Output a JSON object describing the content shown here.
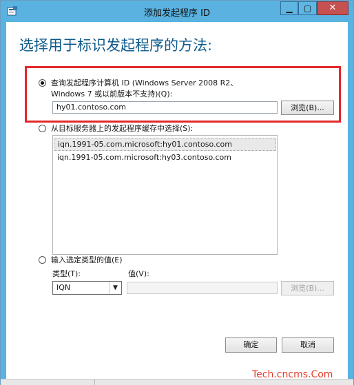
{
  "window": {
    "title": "添加发起程序 ID",
    "controls": {
      "minimize": "▁",
      "maximize": "▢",
      "close": "✕"
    }
  },
  "heading": "选择用于标识发起程序的方法:",
  "option_computer": {
    "label_line1": "查询发起程序计算机 ID (Windows Server 2008 R2、",
    "label_line2": "Windows 7 或以前版本不支持)(Q):",
    "value": "hy01.contoso.com",
    "browse_label": "浏览(B)...",
    "selected": true
  },
  "option_cache": {
    "label": "从目标服务器上的发起程序缓存中选择(S):",
    "items": [
      "iqn.1991-05.com.microsoft:hy01.contoso.com",
      "iqn.1991-05.com.microsoft:hy03.contoso.com"
    ],
    "selected": false
  },
  "option_manual": {
    "label": "输入选定类型的值(E)",
    "type_label": "类型(T):",
    "type_value": "IQN",
    "value_label": "值(V):",
    "value": "",
    "browse_label": "浏览(B)...",
    "selected": false
  },
  "buttons": {
    "ok": "确定",
    "cancel": "取消"
  },
  "watermark": "Tech.cncms.Com",
  "colors": {
    "accent": "#0e5a8a",
    "highlight_border": "#e2262a",
    "title_bar": "#59b2e0"
  }
}
